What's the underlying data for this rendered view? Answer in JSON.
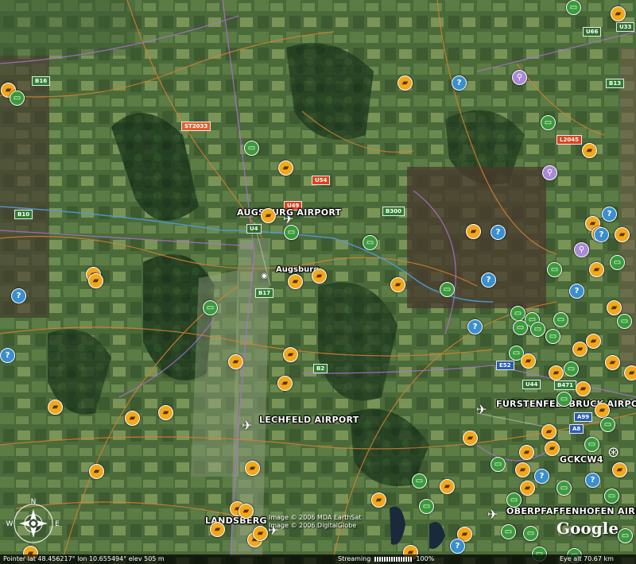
{
  "labels": {
    "augsburg_airport": "AUGSBURG AIRPORT",
    "augsburg": "Augsburg",
    "lechfeld_airport": "LECHFELD AIRPORT",
    "furstenfeldbruck": "FURSTENFELDBRUCK AIRPO",
    "oberpfaffenhofen": "OBERPFAFFENHOFEN AIRP",
    "landsberg": "LANDSBERG",
    "gckcw": "GCKCW4"
  },
  "roads": [
    {
      "label": "B16",
      "kind": "B"
    },
    {
      "label": "ST2033",
      "kind": "ST"
    },
    {
      "label": "U54",
      "kind": "L"
    },
    {
      "label": "U49",
      "kind": "L"
    },
    {
      "label": "B10",
      "kind": "B"
    },
    {
      "label": "B300",
      "kind": "B"
    },
    {
      "label": "B17",
      "kind": "B"
    },
    {
      "label": "B2",
      "kind": "B"
    },
    {
      "label": "U66",
      "kind": "U"
    },
    {
      "label": "U33",
      "kind": "U"
    },
    {
      "label": "B13",
      "kind": "B"
    },
    {
      "label": "L2045",
      "kind": "L"
    },
    {
      "label": "E52",
      "kind": "A"
    },
    {
      "label": "U44",
      "kind": "U"
    },
    {
      "label": "B471",
      "kind": "B"
    },
    {
      "label": "A99",
      "kind": "A"
    },
    {
      "label": "A8",
      "kind": "A"
    },
    {
      "label": "U4",
      "kind": "U"
    }
  ],
  "copyright": {
    "line1": "Image © 2006 MDA EarthSat",
    "line2": "Image © 2006 DigitalGlobe"
  },
  "logo": "Google",
  "compass": {
    "n": "N",
    "e": "E",
    "w": "W"
  },
  "status": {
    "pointer": "Pointer  lat   48.456217°   lon   10.655494°   elev   505 m",
    "streaming_label": "Streaming",
    "streaming_pct": "100%",
    "eye_alt": "Eye  alt    70.67 km"
  },
  "colors": {
    "photo_marker": "#f2a81d",
    "panoramio_marker": "#3b9a3b",
    "info_marker": "#3a8fcf",
    "road_orange": "#d9802e",
    "border_purple": "#b06fd6",
    "river": "#4f9ad8"
  },
  "marker_types": {
    "photo": "camera-icon",
    "pano": "panorama-icon",
    "info": "question-icon",
    "purple": "placemark-icon"
  }
}
